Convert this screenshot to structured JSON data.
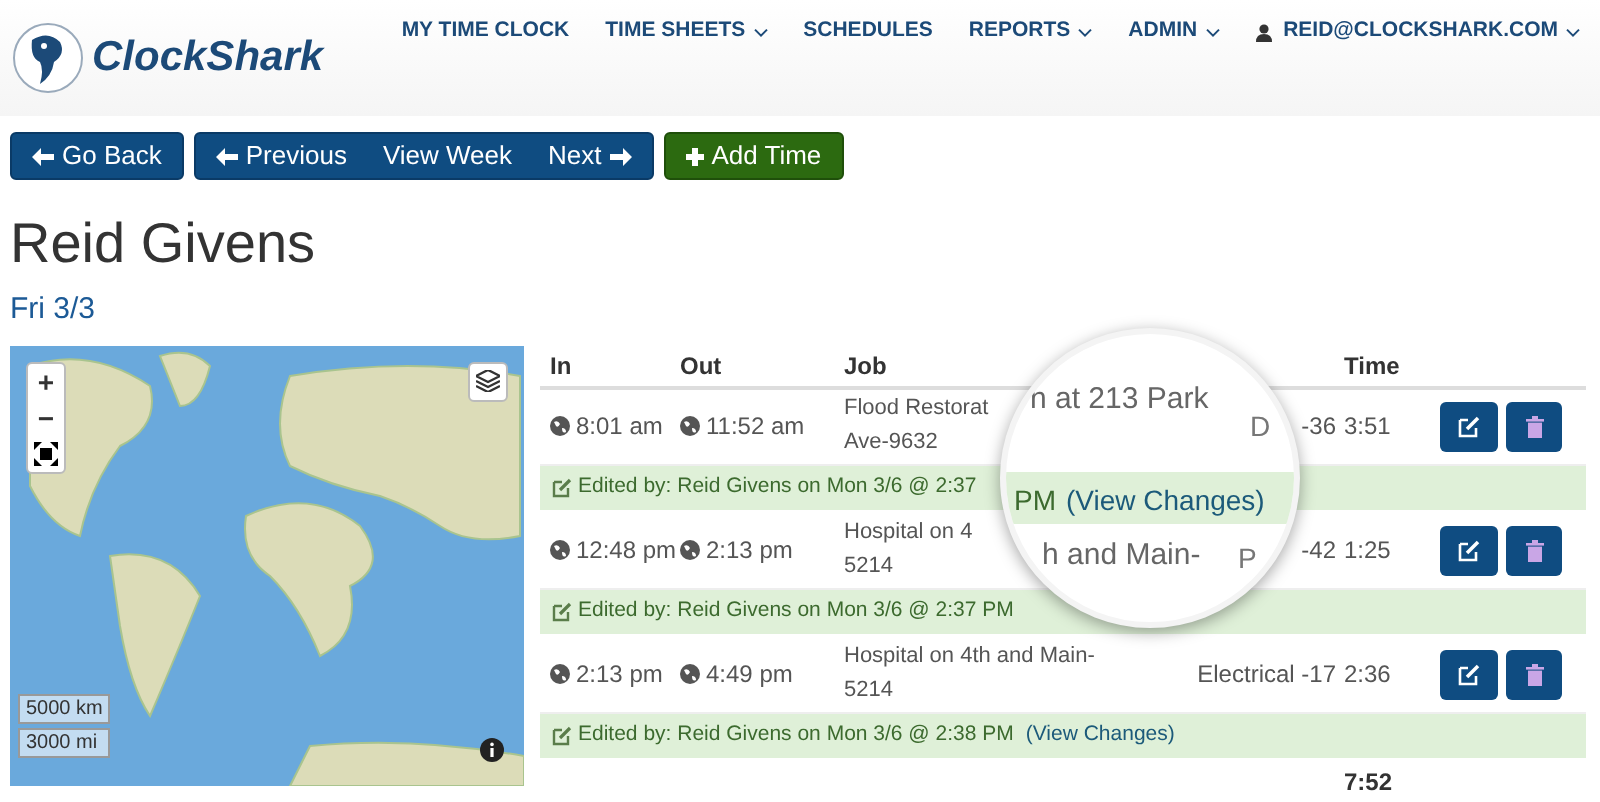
{
  "logo": {
    "text": "ClockShark"
  },
  "nav": [
    {
      "label": "MY TIME CLOCK",
      "dropdown": false
    },
    {
      "label": "TIME SHEETS",
      "dropdown": true
    },
    {
      "label": "SCHEDULES",
      "dropdown": false
    },
    {
      "label": "REPORTS",
      "dropdown": true
    },
    {
      "label": "ADMIN",
      "dropdown": true
    },
    {
      "label": "REID@CLOCKSHARK.COM",
      "dropdown": true,
      "kind": "user"
    }
  ],
  "toolbar": {
    "back": "Go Back",
    "previous": "Previous",
    "week": "View Week",
    "next": "Next",
    "add": "Add Time"
  },
  "title": "Reid Givens",
  "date": "Fri 3/3",
  "map": {
    "zoom_in": "+",
    "zoom_out": "−",
    "scale_km": "5000 km",
    "scale_mi": "3000 mi"
  },
  "table": {
    "columns": [
      "In",
      "Out",
      "Job",
      "",
      "Time"
    ],
    "rows": [
      {
        "in": "8:01 am",
        "out": "11:52 am",
        "job": [
          "Flood Restorat",
          "Ave-9632"
        ],
        "column_4": "-36",
        "time": "3:51",
        "note": "Edited by: Reid Givens on Mon 3/6 @ 2:37"
      },
      {
        "in": "12:48 pm",
        "out": "2:13 pm",
        "job": [
          "Hospital on 4",
          "5214"
        ],
        "column_4": "-42",
        "time": "1:25",
        "note": "Edited by: Reid Givens on Mon 3/6 @ 2:37 PM"
      },
      {
        "in": "2:13 pm",
        "out": "4:49 pm",
        "job": [
          "Hospital on 4th and Main-",
          "5214"
        ],
        "column_4": "Electrical -17",
        "time": "2:36",
        "note": "Edited by: Reid Givens on Mon 3/6 @ 2:38 PM",
        "link": "(View Changes)"
      }
    ],
    "total": "7:52"
  },
  "magnifier": {
    "top_text": "n at 213 Park",
    "note_text": "PM",
    "link": "(View Changes)",
    "bottom_text": "h and Main-",
    "edge_top": "D",
    "edge_bottom": "P"
  }
}
